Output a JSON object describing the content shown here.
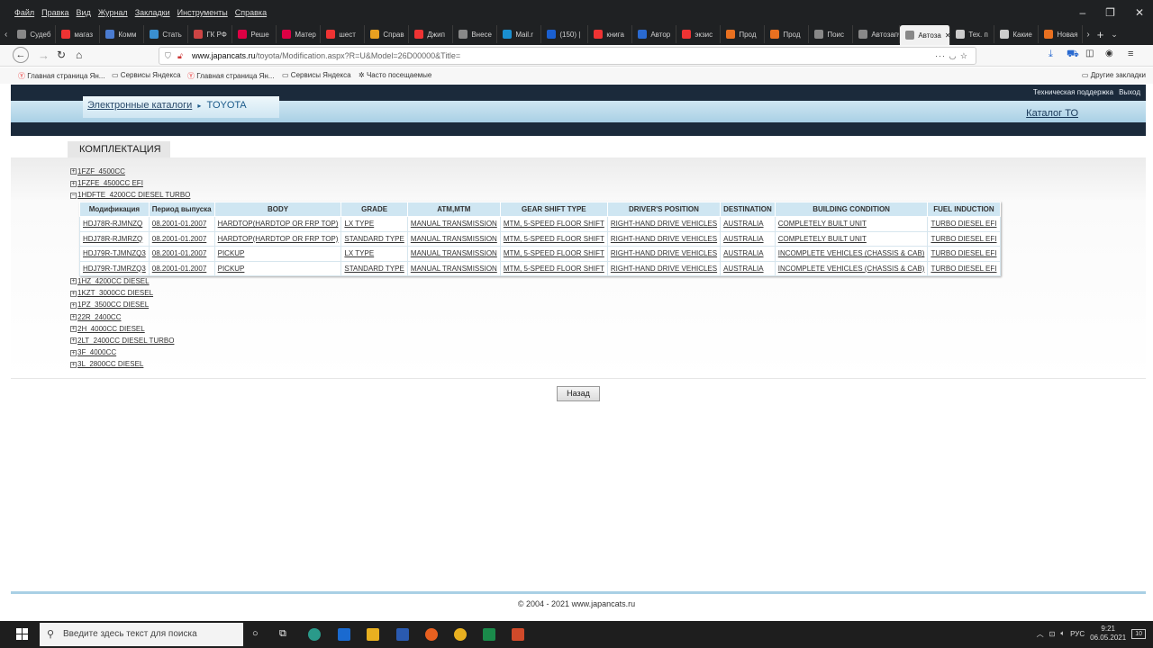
{
  "browser": {
    "menu": [
      "Файл",
      "Правка",
      "Вид",
      "Журнал",
      "Закладки",
      "Инструменты",
      "Справка"
    ],
    "tabs": [
      {
        "label": "Судеб",
        "color": "#888"
      },
      {
        "label": "магаз",
        "color": "#e33"
      },
      {
        "label": "Комм",
        "color": "#4a7bd0"
      },
      {
        "label": "Стать",
        "color": "#3a8fd0"
      },
      {
        "label": "ГК РФ",
        "color": "#c44"
      },
      {
        "label": "Реше",
        "color": "#d04"
      },
      {
        "label": "Матер",
        "color": "#d04"
      },
      {
        "label": "шест",
        "color": "#e33"
      },
      {
        "label": "Справ",
        "color": "#e8a020"
      },
      {
        "label": "Джип",
        "color": "#e33"
      },
      {
        "label": "Внесе",
        "color": "#888"
      },
      {
        "label": "Mail.r",
        "color": "#1a8fd0"
      },
      {
        "label": "(150) |",
        "color": "#1a5fd0"
      },
      {
        "label": "книга",
        "color": "#e33"
      },
      {
        "label": "Автор",
        "color": "#2a6ad0"
      },
      {
        "label": "экзис",
        "color": "#e33"
      },
      {
        "label": "Прод",
        "color": "#e87020"
      },
      {
        "label": "Прод",
        "color": "#e87020"
      },
      {
        "label": "Поис",
        "color": "#888"
      },
      {
        "label": "Автозапч",
        "color": "#888"
      },
      {
        "label": "Автоза",
        "color": "#888",
        "active": true
      },
      {
        "label": "Тех. п",
        "color": "#ccc"
      },
      {
        "label": "Какие",
        "color": "#ccc"
      },
      {
        "label": "Новая",
        "color": "#e87020"
      }
    ],
    "url_host": "www.japancats.ru",
    "url_path": "/toyota/Modification.aspx?R=U&Model=26D00000&Title=",
    "bookmarks": [
      "Главная страница Ян...",
      "Сервисы Яндекса",
      "Главная страница Ян...",
      "Сервисы Яндекса",
      "Часто посещаемые"
    ],
    "other_bookmarks": "Другие закладки"
  },
  "site": {
    "top_links": [
      "Техническая поддержка",
      "Выход"
    ],
    "breadcrumb_link": "Электронные каталоги",
    "breadcrumb_sep": "▸",
    "breadcrumb_current": "TOYOTA",
    "catalog_link": "Каталог ТО",
    "section_title": "КОМПЛЕКТАЦИЯ",
    "tree_before": [
      {
        "sign": "+",
        "label": "1FZF_4500CC"
      },
      {
        "sign": "+",
        "label": "1FZFE_4500CC EFI"
      },
      {
        "sign": "−",
        "label": "1HDFTE_4200CC DIESEL TURBO"
      }
    ],
    "table_headers": [
      "Модификация",
      "Период выпуска",
      "BODY",
      "GRADE",
      "ATM,MTM",
      "GEAR SHIFT TYPE",
      "DRIVER'S POSITION",
      "DESTINATION",
      "BUILDING CONDITION",
      "FUEL INDUCTION"
    ],
    "rows": [
      [
        "HDJ78R-RJMNZQ",
        "08.2001-01.2007",
        "HARDTOP(HARDTOP OR FRP TOP)",
        "LX TYPE",
        "MANUAL TRANSMISSION",
        "MTM, 5-SPEED FLOOR SHIFT",
        "RIGHT-HAND DRIVE VEHICLES",
        "AUSTRALIA",
        "COMPLETELY BUILT UNIT",
        "TURBO DIESEL EFI"
      ],
      [
        "HDJ78R-RJMRZQ",
        "08.2001-01.2007",
        "HARDTOP(HARDTOP OR FRP TOP)",
        "STANDARD TYPE",
        "MANUAL TRANSMISSION",
        "MTM, 5-SPEED FLOOR SHIFT",
        "RIGHT-HAND DRIVE VEHICLES",
        "AUSTRALIA",
        "COMPLETELY BUILT UNIT",
        "TURBO DIESEL EFI"
      ],
      [
        "HDJ79R-TJMNZQ3",
        "08.2001-01.2007",
        "PICKUP",
        "LX TYPE",
        "MANUAL TRANSMISSION",
        "MTM, 5-SPEED FLOOR SHIFT",
        "RIGHT-HAND DRIVE VEHICLES",
        "AUSTRALIA",
        "INCOMPLETE VEHICLES (CHASSIS & CAB)",
        "TURBO DIESEL EFI"
      ],
      [
        "HDJ79R-TJMRZQ3",
        "08.2001-01.2007",
        "PICKUP",
        "STANDARD TYPE",
        "MANUAL TRANSMISSION",
        "MTM, 5-SPEED FLOOR SHIFT",
        "RIGHT-HAND DRIVE VEHICLES",
        "AUSTRALIA",
        "INCOMPLETE VEHICLES (CHASSIS & CAB)",
        "TURBO DIESEL EFI"
      ]
    ],
    "tree_after": [
      {
        "sign": "+",
        "label": "1HZ_4200CC DIESEL"
      },
      {
        "sign": "+",
        "label": "1KZT_3000CC DIESEL"
      },
      {
        "sign": "+",
        "label": "1PZ_3500CC DIESEL"
      },
      {
        "sign": "+",
        "label": "22R_2400CC"
      },
      {
        "sign": "+",
        "label": "2H_4000CC DIESEL"
      },
      {
        "sign": "+",
        "label": "2LT_2400CC DIESEL TURBO"
      },
      {
        "sign": "+",
        "label": "3F_4000CC"
      },
      {
        "sign": "+",
        "label": "3L_2800CC DIESEL"
      }
    ],
    "back_button": "Назад",
    "footer": "© 2004 - 2021 www.japancats.ru"
  },
  "taskbar": {
    "search_placeholder": "Введите здесь текст для поиска",
    "tray_lang": "РУС",
    "time": "9:21",
    "date": "06.05.2021",
    "notifications": "10"
  }
}
